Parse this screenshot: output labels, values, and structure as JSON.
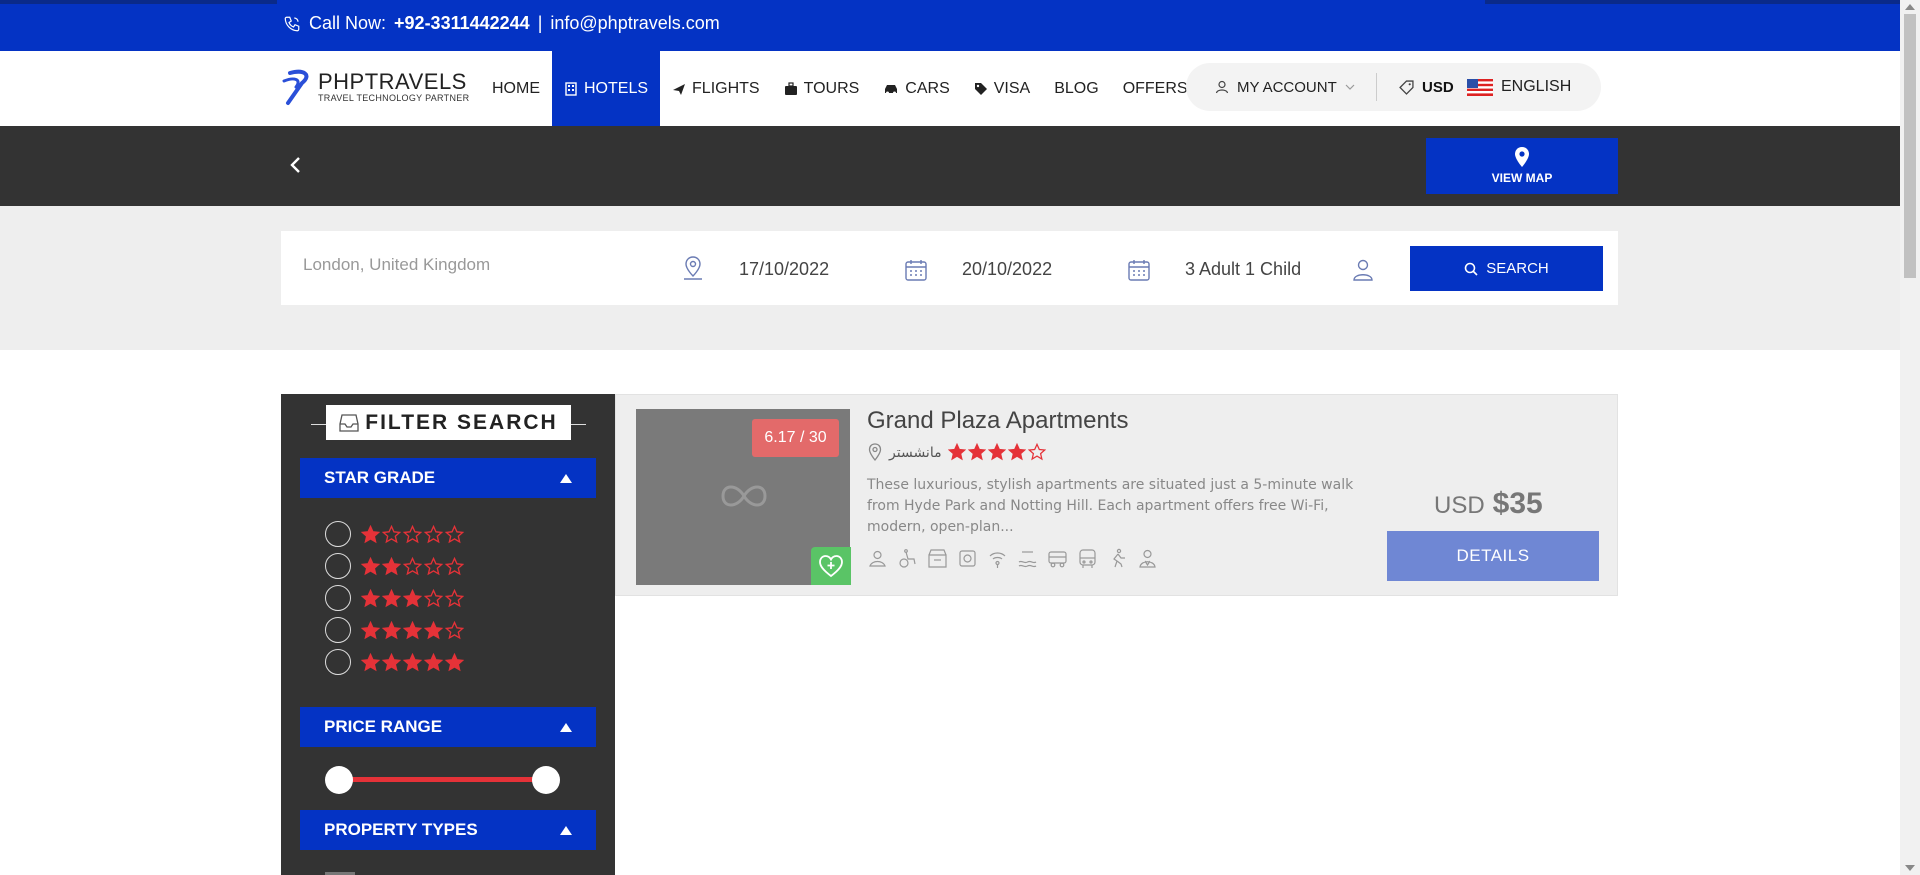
{
  "topbar": {
    "call_label": "Call Now:",
    "phone": "+92-3311442244",
    "separator": "|",
    "email": "info@phptravels.com"
  },
  "logo": {
    "name": "PHPTRAVELS",
    "tagline": "TRAVEL TECHNOLOGY PARTNER"
  },
  "menu": {
    "home": "HOME",
    "hotels": "HOTELS",
    "flights": "FLIGHTS",
    "tours": "TOURS",
    "cars": "CARS",
    "visa": "VISA",
    "blog": "BLOG",
    "offers": "OFFERS"
  },
  "account": {
    "my_account": "MY ACCOUNT",
    "currency": "USD",
    "language": "ENGLISH"
  },
  "view_map": "VIEW MAP",
  "search": {
    "location": "London, United Kingdom",
    "checkin": "17/10/2022",
    "checkout": "20/10/2022",
    "guests": "3 Adult 1 Child",
    "button": "SEARCH"
  },
  "filters": {
    "title": "FILTER SEARCH",
    "star_grade": "STAR GRADE",
    "star_options": [
      1,
      2,
      3,
      4,
      5
    ],
    "price_range": "PRICE RANGE",
    "property_types": "PROPERTY TYPES"
  },
  "hotel": {
    "title": "Grand Plaza Apartments",
    "rating_badge": "6.17 / 30",
    "location": "مانشستر",
    "stars": 4,
    "description": "These luxurious, stylish apartments are situated just a 5-minute walk from Hyde Park and Notting Hill. Each apartment offers free Wi-Fi, modern, open-plan...",
    "currency": "USD",
    "price": "$35",
    "details_button": "DETAILS"
  },
  "colors": {
    "primary": "#0433c4",
    "dark": "#333333",
    "star": "#e53238",
    "badge": "#e36a6a",
    "favorite": "#5ac466"
  }
}
